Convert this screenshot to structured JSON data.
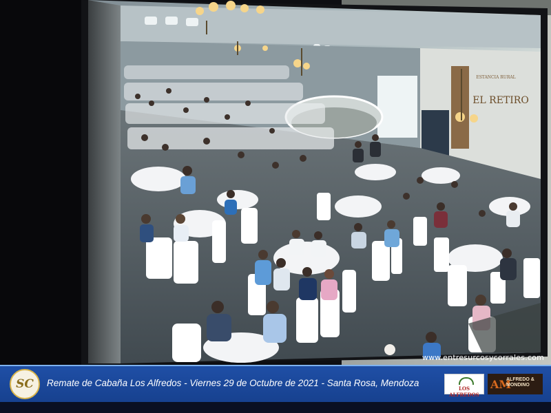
{
  "watermark": {
    "url": "www.entresurcosycorrales.com"
  },
  "caption": {
    "logo_text": "SC",
    "text": "Remate de Cabaña Los Alfredos - Viernes 29 de Octubre de 2021 - Santa Rosa, Mendoza"
  },
  "screen_sign": {
    "line1": "ESTANCIA RURAL",
    "line2": "EL RETIRO"
  },
  "sponsor_logos": {
    "alfredos": "LOS ALFREDOS",
    "mondino_mark": "AM",
    "mondino_name": "ALFREDO & MONDINO"
  },
  "colors": {
    "caption_bar": "#1f4fa6",
    "caption_border": "#7fb3f0",
    "accent_gold": "#d8b44a"
  }
}
